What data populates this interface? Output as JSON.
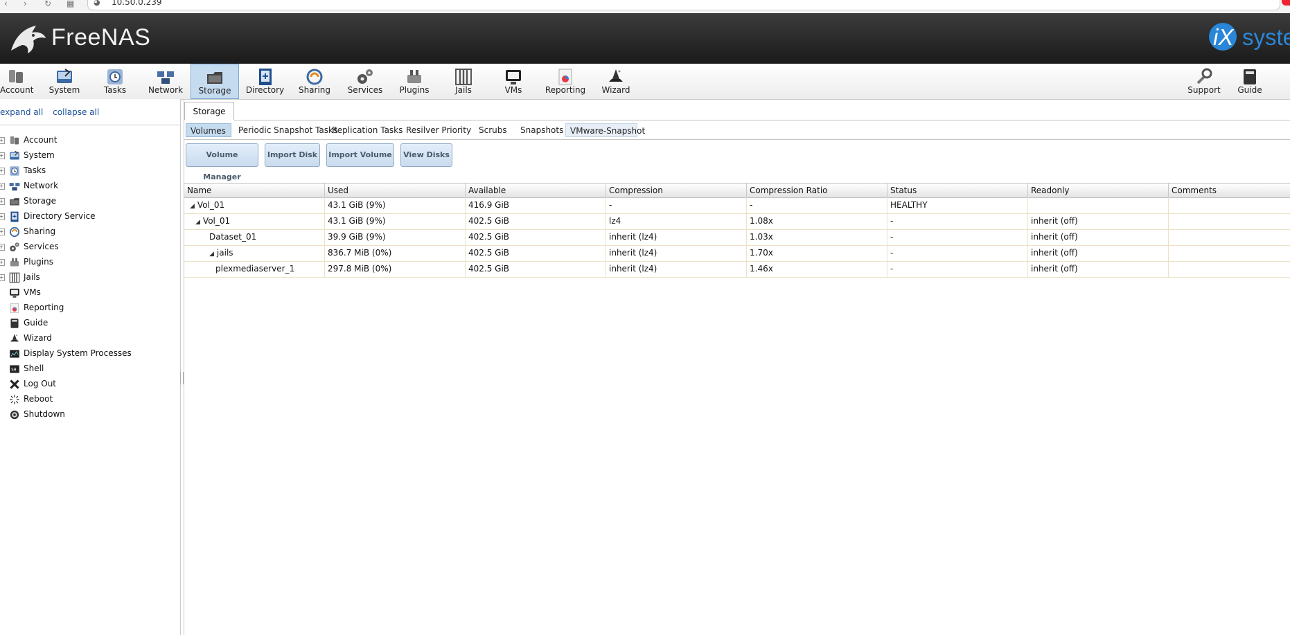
{
  "browser": {
    "url": "10.50.0.239"
  },
  "header": {
    "logo_text": "FreeNAS",
    "logo_tm": "",
    "vendor_prefix": "iX",
    "vendor_suffix": "system"
  },
  "toolbar": {
    "items": [
      {
        "label": "Account",
        "icon": "account-icon"
      },
      {
        "label": "System",
        "icon": "system-icon"
      },
      {
        "label": "Tasks",
        "icon": "tasks-icon"
      },
      {
        "label": "Network",
        "icon": "network-icon"
      },
      {
        "label": "Storage",
        "icon": "storage-icon"
      },
      {
        "label": "Directory",
        "icon": "directory-icon"
      },
      {
        "label": "Sharing",
        "icon": "sharing-icon"
      },
      {
        "label": "Services",
        "icon": "services-icon"
      },
      {
        "label": "Plugins",
        "icon": "plugins-icon"
      },
      {
        "label": "Jails",
        "icon": "jails-icon"
      },
      {
        "label": "VMs",
        "icon": "vms-icon"
      },
      {
        "label": "Reporting",
        "icon": "reporting-icon"
      },
      {
        "label": "Wizard",
        "icon": "wizard-icon"
      }
    ],
    "right_items": [
      {
        "label": "Support",
        "icon": "support-icon"
      },
      {
        "label": "Guide",
        "icon": "guide-icon"
      }
    ],
    "active": "Storage"
  },
  "tree": {
    "expand_all": "expand all",
    "collapse_all": "collapse all",
    "items": [
      {
        "label": "Account",
        "expandable": true
      },
      {
        "label": "System",
        "expandable": true
      },
      {
        "label": "Tasks",
        "expandable": true
      },
      {
        "label": "Network",
        "expandable": true
      },
      {
        "label": "Storage",
        "expandable": true
      },
      {
        "label": "Directory Service",
        "expandable": true
      },
      {
        "label": "Sharing",
        "expandable": true
      },
      {
        "label": "Services",
        "expandable": true
      },
      {
        "label": "Plugins",
        "expandable": true
      },
      {
        "label": "Jails",
        "expandable": true
      },
      {
        "label": "VMs",
        "expandable": false
      },
      {
        "label": "Reporting",
        "expandable": false
      },
      {
        "label": "Guide",
        "expandable": false
      },
      {
        "label": "Wizard",
        "expandable": false
      },
      {
        "label": "Display System Processes",
        "expandable": false
      },
      {
        "label": "Shell",
        "expandable": false
      },
      {
        "label": "Log Out",
        "expandable": false
      },
      {
        "label": "Reboot",
        "expandable": false
      },
      {
        "label": "Shutdown",
        "expandable": false
      }
    ]
  },
  "main": {
    "tab": "Storage",
    "subtabs": [
      {
        "label": "Volumes",
        "state": "active"
      },
      {
        "label": "Periodic Snapshot Tasks",
        "state": ""
      },
      {
        "label": "Replication Tasks",
        "state": ""
      },
      {
        "label": "Resilver Priority",
        "state": ""
      },
      {
        "label": "Scrubs",
        "state": ""
      },
      {
        "label": "Snapshots",
        "state": ""
      },
      {
        "label": "VMware-Snapshot",
        "state": "hover"
      }
    ],
    "buttons": [
      {
        "label": "Volume Manager"
      },
      {
        "label": "Import Disk"
      },
      {
        "label": "Import Volume"
      },
      {
        "label": "View Disks"
      }
    ]
  },
  "grid": {
    "columns": [
      "Name",
      "Used",
      "Available",
      "Compression",
      "Compression Ratio",
      "Status",
      "Readonly",
      "Comments"
    ],
    "rows": [
      {
        "level": 0,
        "expander": true,
        "cells": [
          "Vol_01",
          "43.1 GiB (9%)",
          "416.9 GiB",
          "-",
          "-",
          "HEALTHY",
          "",
          ""
        ]
      },
      {
        "level": 1,
        "expander": true,
        "cells": [
          "Vol_01",
          "43.1 GiB (9%)",
          "402.5 GiB",
          "lz4",
          "1.08x",
          "-",
          "inherit (off)",
          ""
        ]
      },
      {
        "level": 2,
        "expander": false,
        "cells": [
          "Dataset_01",
          "39.9 GiB (9%)",
          "402.5 GiB",
          "inherit (lz4)",
          "1.03x",
          "-",
          "inherit (off)",
          ""
        ]
      },
      {
        "level": 2,
        "expander": true,
        "cells": [
          "jails",
          "836.7 MiB (0%)",
          "402.5 GiB",
          "inherit (lz4)",
          "1.70x",
          "-",
          "inherit (off)",
          ""
        ]
      },
      {
        "level": 3,
        "expander": false,
        "cells": [
          "plexmediaserver_1",
          "297.8 MiB (0%)",
          "402.5 GiB",
          "inherit (lz4)",
          "1.46x",
          "-",
          "inherit (off)",
          ""
        ]
      }
    ]
  }
}
